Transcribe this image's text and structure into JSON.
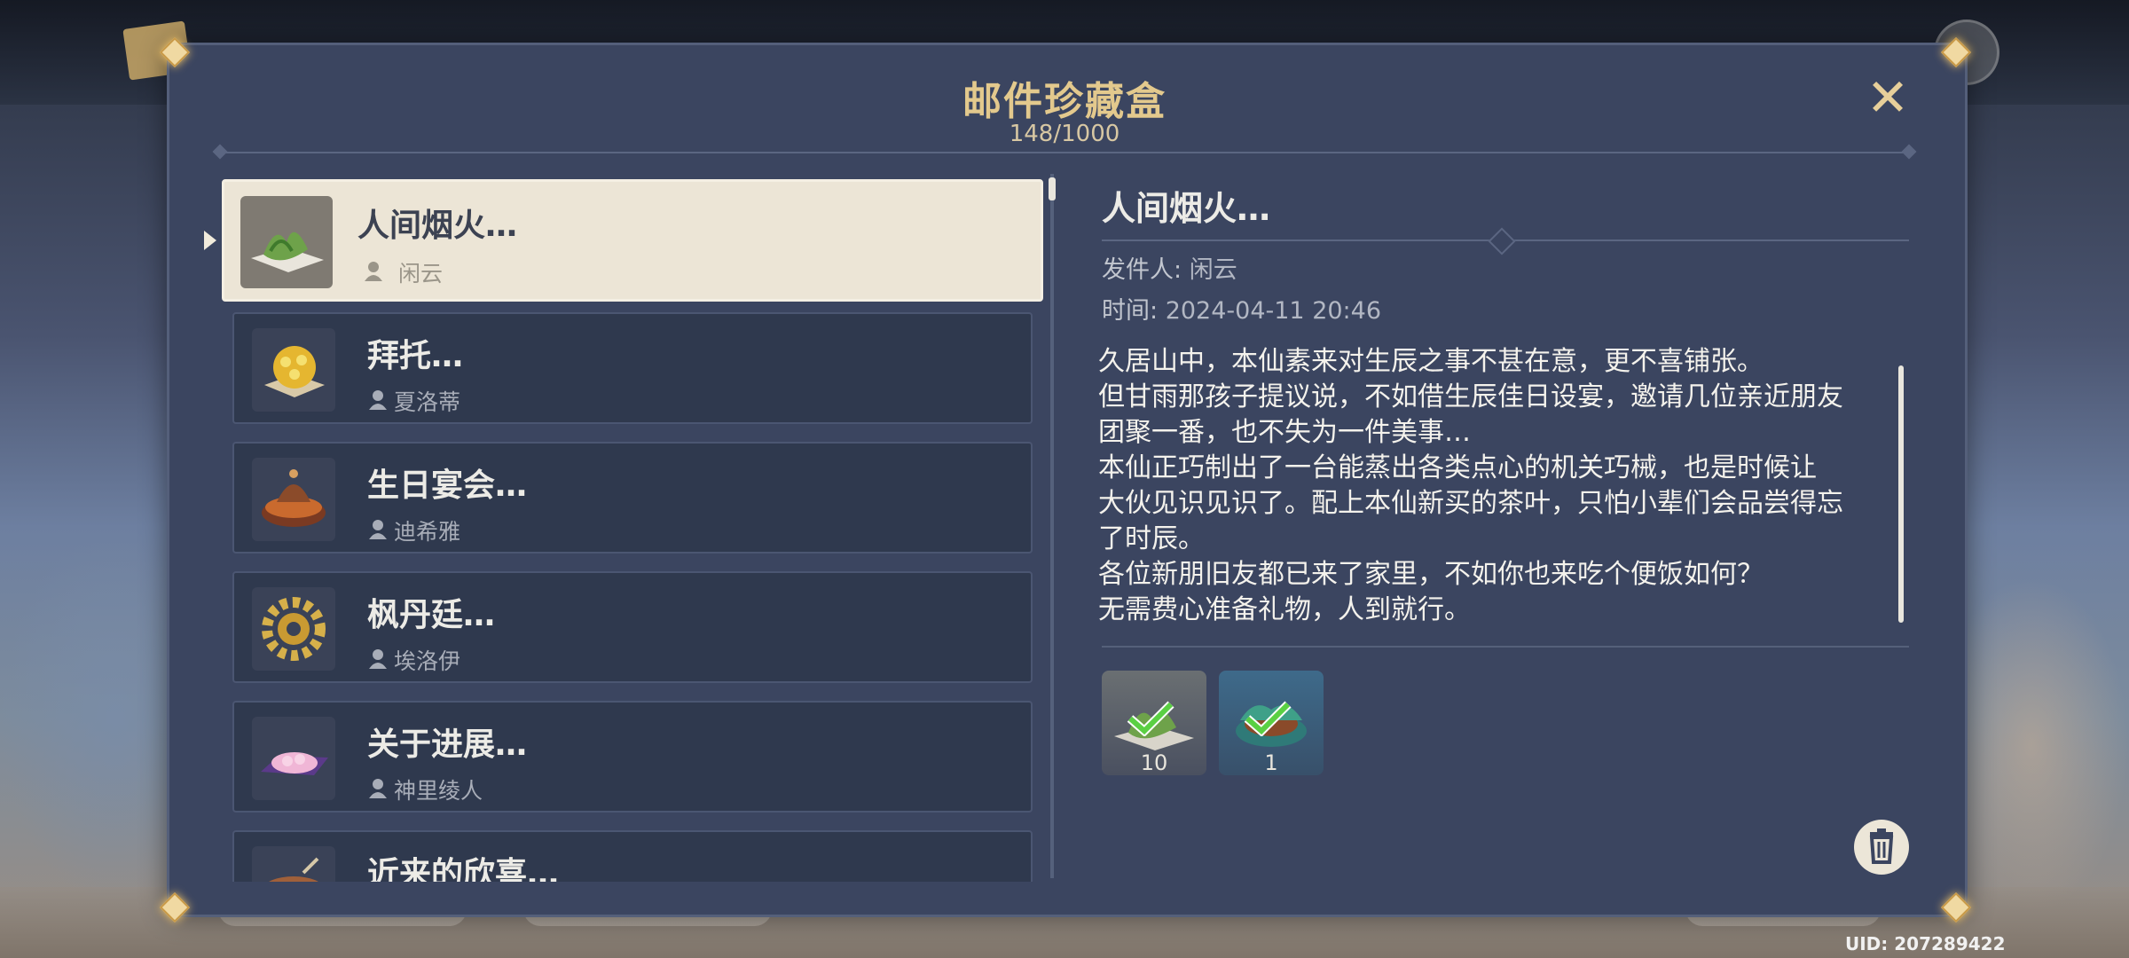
{
  "mailbox": {
    "title": "邮件珍藏盒",
    "count": "148/1000"
  },
  "mails": [
    {
      "title": "人间烟火…",
      "sender": "闲云",
      "icon": "herb-dish-icon"
    },
    {
      "title": "拜托…",
      "sender": "夏洛蒂",
      "icon": "yellow-flower-pastry-icon"
    },
    {
      "title": "生日宴会…",
      "sender": "迪希雅",
      "icon": "stew-pot-icon"
    },
    {
      "title": "枫丹廷…",
      "sender": "埃洛伊",
      "icon": "golden-gear-icon"
    },
    {
      "title": "关于进展…",
      "sender": "神里绫人",
      "icon": "pink-flower-tray-icon"
    },
    {
      "title": "近来的欣喜…",
      "sender": "",
      "icon": "dish-icon"
    }
  ],
  "detail": {
    "title": "人间烟火…",
    "sender_label": "发件人:",
    "sender": "闲云",
    "time_label": "时间:",
    "time": "2024-04-11 20:46",
    "body": [
      "久居山中，本仙素来对生辰之事不甚在意，更不喜铺张。",
      "但甘雨那孩子提议说，不如借生辰佳日设宴，邀请几位亲近朋友",
      "团聚一番，也不失为一件美事…",
      "本仙正巧制出了一台能蒸出各类点心的机关巧械，也是时候让",
      "大伙见识见识了。配上本仙新买的茶叶，只怕小辈们会品尝得忘",
      "了时辰。",
      "各位新朋旧友都已来了家里，不如你也来吃个便饭如何？",
      "无需费心准备礼物，人到就行。"
    ],
    "rewards": [
      {
        "count": "10",
        "icon": "herb-dish-icon",
        "claimed": true
      },
      {
        "count": "1",
        "icon": "bowl-dish-icon",
        "claimed": true
      }
    ]
  },
  "footer": {
    "uid": "UID: 207289422"
  },
  "colors": {
    "panel": "#3b4560",
    "title_gold": "#e3c98d",
    "selected_bg": "#ece5d6",
    "check_green": "#5ad043"
  }
}
